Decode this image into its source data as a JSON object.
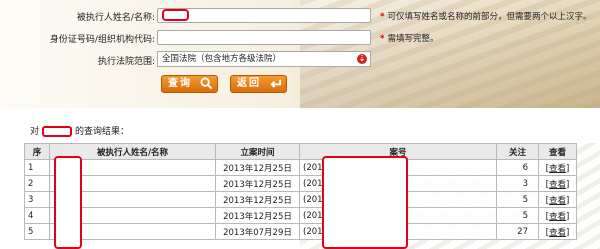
{
  "form": {
    "name_label": "被执行人姓名/名称:",
    "name_hint": "可仅填写姓名或名称的前部分，但需要两个以上汉字。",
    "id_label": "身份证号码/组织机构代码:",
    "id_hint": "需填写完整。",
    "court_label": "执行法院范围:",
    "court_value": "全国法院（包含地方各级法院）",
    "hint_star": "*",
    "dropdown_icon": "down-arrow-icon"
  },
  "buttons": {
    "search_label": "查询",
    "back_label": "返回"
  },
  "results": {
    "prefix": "对",
    "suffix": "的查询结果："
  },
  "table": {
    "headers": [
      "序",
      "被执行人姓名/名称",
      "立案时间",
      "案号",
      "关注",
      "查看"
    ],
    "rows": [
      {
        "no": "1",
        "date": "2013年12月25日",
        "case": "(2014",
        "follow": "6",
        "view": "[查看]"
      },
      {
        "no": "2",
        "date": "2013年12月25日",
        "case": "(2014",
        "follow": "3",
        "view": "[查看]"
      },
      {
        "no": "3",
        "date": "2013年12月25日",
        "case": "(2014",
        "follow": "5",
        "view": "[查看]"
      },
      {
        "no": "4",
        "date": "2013年12月25日",
        "case": "(2014",
        "follow": "5",
        "view": "[查看]"
      },
      {
        "no": "5",
        "date": "2013年07月29日",
        "case": "(2013",
        "follow": "27",
        "view": "[查看]"
      }
    ]
  },
  "colors": {
    "accent_orange": "#e8801a",
    "redaction_red": "#e4001b",
    "star_red": "#d40000"
  }
}
